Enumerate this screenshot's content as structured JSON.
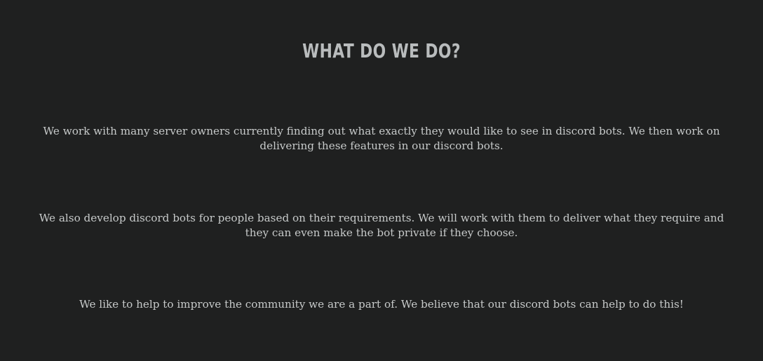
{
  "section": {
    "title": "WHAT DO WE DO?",
    "paragraphs": [
      "We work with many server owners currently finding out what exactly they would like to see in discord bots. We then work on delivering these features in our discord bots.",
      "We also develop discord bots for people based on their requirements. We will work with them to deliver what they require and they can even make the bot private if they choose.",
      "We like to help to improve the community we are a part of. We believe that our discord bots can help to do this!"
    ]
  },
  "colors": {
    "background": "#1f2020",
    "heading": "#b9bcbd",
    "text": "#c7caca"
  }
}
